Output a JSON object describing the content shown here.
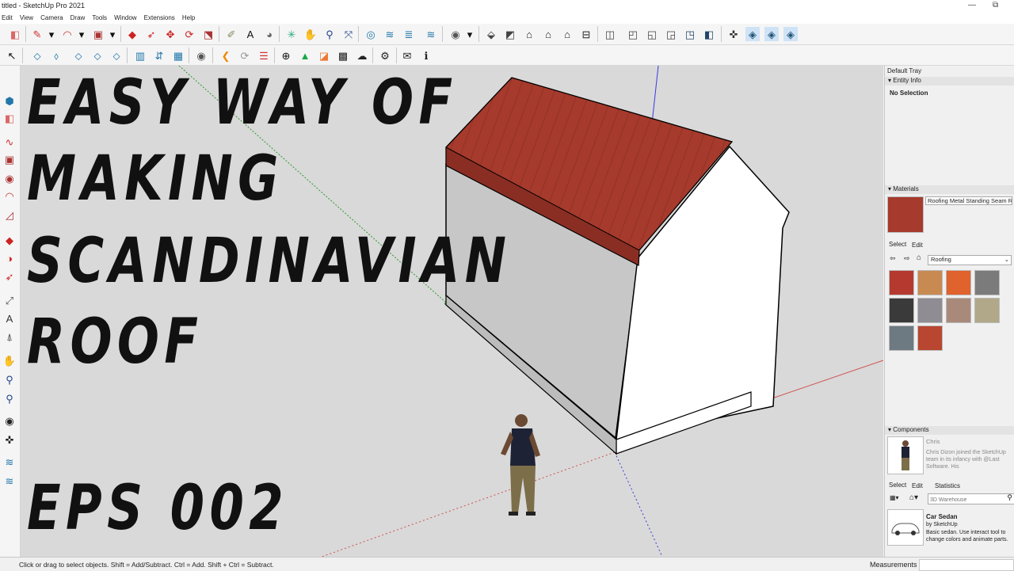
{
  "window": {
    "title": "titled - SketchUp Pro 2021",
    "restore_glyph": "⧉",
    "minimize_glyph": "—"
  },
  "menu": [
    "Edit",
    "View",
    "Camera",
    "Draw",
    "Tools",
    "Window",
    "Extensions",
    "Help"
  ],
  "overlay": {
    "lines": [
      "EASY WAY OF",
      "MAKING",
      "SCANDINAVIAN",
      "ROOF"
    ],
    "episode": "EPS 002"
  },
  "tray": {
    "title": "Default Tray",
    "entity_info": {
      "header": "Entity Info",
      "selection": "No Selection"
    },
    "materials": {
      "header": "Materials",
      "current_name": "Roofing Metal Standing Seam R",
      "tabs": [
        "Select",
        "Edit"
      ],
      "library": "Roofing",
      "swatch_colors": [
        "#b5392f",
        "#c98a52",
        "#e0622d",
        "#7b7b7b",
        "#3a3a3a",
        "#8f8c93",
        "#a98a7a",
        "#b0a888",
        "#6e7a82",
        "#b84631"
      ]
    },
    "components": {
      "header": "Components",
      "name": "Chris",
      "description": "Chris Dizon joined the SketchUp team in its infancy with @Last Software. His",
      "tabs": [
        "Select",
        "Edit",
        "Statistics"
      ],
      "search_placeholder": "3D Warehouse",
      "item": {
        "name": "Car Sedan",
        "author": "by SketchUp",
        "desc": "Basic sedan.  Use interact tool to change colors and animate parts."
      }
    }
  },
  "status": {
    "message": "Click or drag to select objects. Shift = Add/Subtract. Ctrl = Add. Shift + Ctrl = Subtract.",
    "measurements_label": "Measurements"
  },
  "colors": {
    "roof": "#a63a2c",
    "viewport_bg": "#d9d9d9",
    "wall_side": "#c7c7c7",
    "wall_front": "#ffffff"
  }
}
